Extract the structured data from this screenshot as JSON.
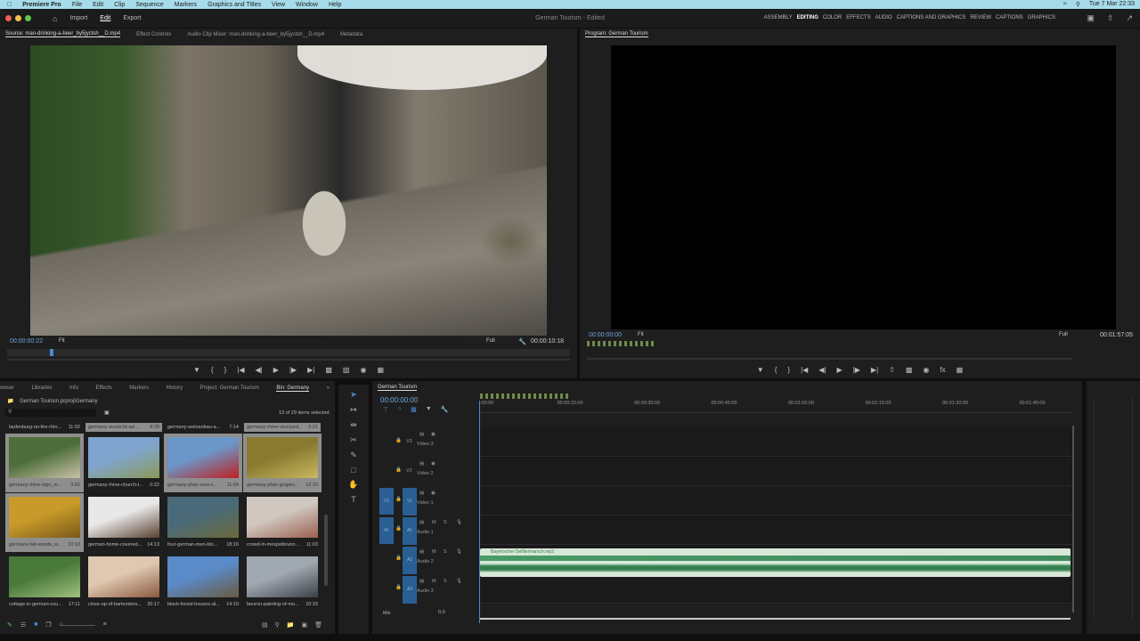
{
  "menubar": {
    "app": "Premiere Pro",
    "items": [
      "File",
      "Edit",
      "Clip",
      "Sequence",
      "Markers",
      "Graphics and Titles",
      "View",
      "Window",
      "Help"
    ],
    "clock": "Tue 7 Mar 22:33"
  },
  "header": {
    "nav": [
      "Import",
      "Edit",
      "Export"
    ],
    "title": "German Tourism",
    "status": "- Edited",
    "workspaces": [
      "ASSEMBLY",
      "EDITING",
      "COLOR",
      "EFFECTS",
      "AUDIO",
      "CAPTIONS AND GRAPHICS",
      "REVIEW",
      "CAPTIONS",
      "GRAPHICS"
    ]
  },
  "source": {
    "tabs": [
      "Source: man-drinking-a-beer_by5jyctsh__D.mp4",
      "Effect Controls",
      "Audio Clip Mixer: man-drinking-a-beer_by5jyctsh__D.mp4",
      "Metadata"
    ],
    "timecode": "00:00:00:22",
    "fit": "Fit",
    "quality": "Full",
    "duration": "00:00:10:18"
  },
  "program": {
    "tab": "Program: German Tourism",
    "timecode": "00:00:00:00",
    "fit": "Fit",
    "quality": "Full",
    "duration": "00:01:57:05"
  },
  "project": {
    "tabs": [
      "owser",
      "Libraries",
      "Info",
      "Effects",
      "Markers",
      "History",
      "Project: German Tourism",
      "Bin: Germany"
    ],
    "path": "German Tourism.prproj\\Germany",
    "selection": "13 of 29 items selected",
    "top_labels": [
      {
        "name": "laufenburg-on-the-rhin...",
        "dur": "11:02",
        "sel": false
      },
      {
        "name": "germany-aussicht-spi...",
        "dur": "8:28",
        "sel": true
      },
      {
        "name": "germany-weinanbau-a...",
        "dur": "7:14",
        "sel": false
      },
      {
        "name": "germany-rhine-vineyard...",
        "dur": "9:21",
        "sel": true
      }
    ],
    "items": [
      {
        "name": "germany-rhine-sign_w...",
        "dur": "3:02",
        "sel": true,
        "colors": [
          "#4d6e3a",
          "#c9c2a8"
        ]
      },
      {
        "name": "germany-rhine-church-t...",
        "dur": "0:22",
        "sel": false,
        "colors": [
          "#7fa5cf",
          "#8b9a5a"
        ]
      },
      {
        "name": "germany-pfalz-rose-t...",
        "dur": "11:04",
        "sel": true,
        "colors": [
          "#6a97c8",
          "#c02020"
        ]
      },
      {
        "name": "germany-pfalz-grapes...",
        "dur": "12:10",
        "sel": true,
        "colors": [
          "#8a7a30",
          "#c8b860"
        ]
      },
      {
        "name": "germany-fall-woods_w...",
        "dur": "10:10",
        "sel": true,
        "colors": [
          "#c89a2a",
          "#7a5a1a"
        ]
      },
      {
        "name": "german-home-covered...",
        "dur": "14:13",
        "sel": false,
        "colors": [
          "#e8e8e8",
          "#5a4030"
        ]
      },
      {
        "name": "four-german-men-blo...",
        "dur": "18:16",
        "sel": false,
        "colors": [
          "#4a6a7a",
          "#6a6a3a"
        ]
      },
      {
        "name": "crowd-in-mespelbrunn...",
        "dur": "11:03",
        "sel": false,
        "colors": [
          "#d0c8c0",
          "#9a6050"
        ]
      },
      {
        "name": "cottage-in-german-cou...",
        "dur": "17:11",
        "sel": false,
        "colors": [
          "#4a7a3a",
          "#a0c080"
        ]
      },
      {
        "name": "close-up-of-bartenders...",
        "dur": "30:17",
        "sel": false,
        "colors": [
          "#e0c8b0",
          "#8a5a40"
        ]
      },
      {
        "name": "black-forest-houses-al...",
        "dur": "14:19",
        "sel": false,
        "colors": [
          "#5a8ac8",
          "#6a5a40"
        ]
      },
      {
        "name": "beuron-painting-of-mo...",
        "dur": "10:15",
        "sel": false,
        "colors": [
          "#a0a8b0",
          "#3a4048"
        ]
      }
    ]
  },
  "timeline": {
    "tab": "German Tourism",
    "timecode": "00:00:00:00",
    "ruler": [
      ":00:00",
      "00:00:15:00",
      "00:00:30:00",
      "00:00:45:00",
      "00:01:00:00",
      "00:01:15:00",
      "00:01:30:00",
      "00:01:45:00"
    ],
    "tracks": [
      {
        "id": "V3",
        "name": "Video 3"
      },
      {
        "id": "V2",
        "name": "Video 2"
      },
      {
        "id": "V1",
        "name": "Video 1",
        "src": "V1"
      },
      {
        "id": "A1",
        "name": "Audio 1",
        "src": "A1"
      },
      {
        "id": "A2",
        "name": "Audio 2"
      },
      {
        "id": "A3",
        "name": "Audio 3"
      }
    ],
    "mix_label": "Mix",
    "mix_value": "0.0",
    "clip": "Bayerischer Defiliermarsch.mp3",
    "m": "M",
    "s": "S"
  }
}
